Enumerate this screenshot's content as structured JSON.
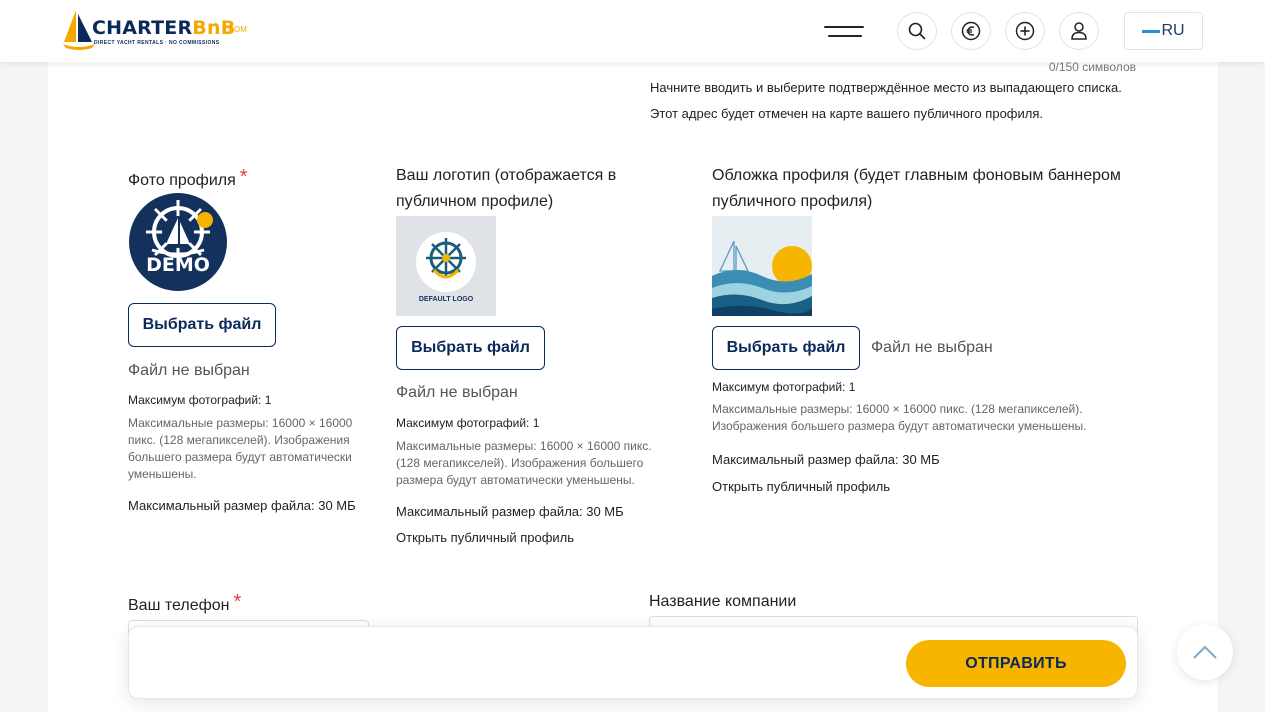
{
  "header": {
    "logo": {
      "brand_part1": "CHARTER",
      "brand_part2": "BnB",
      "domain": ".COM",
      "tagline": "DIRECT YACHT RENTALS · NO COMMISSIONS"
    },
    "icons": [
      "menu-icon",
      "search-icon",
      "euro-icon",
      "plus-circle-icon",
      "user-icon"
    ],
    "language": "RU"
  },
  "address": {
    "counter": "0/150 символов",
    "help": "Начните вводить и выберите подтверждённое место из выпадающего списка. Этот адрес будет отмечен на карте вашего публичного профиля."
  },
  "profile_photo": {
    "label": "Фото профиля",
    "required_mark": "*",
    "image_text": "DEMO",
    "button": "Выбрать файл",
    "no_file": "Файл не выбран",
    "max_photos": "Максимум фотографий: 1",
    "max_dims": "Максимальные размеры: 16000 × 16000 пикс. (128 мегапикселей). Изображения большего размера будут автоматически уменьшены.",
    "max_size": "Максимальный размер файла: 30 МБ"
  },
  "logo_upload": {
    "label": "Ваш логотип (отображается в публичном профиле)",
    "image_text": "DEFAULT LOGO",
    "button": "Выбрать файл",
    "no_file": "Файл не выбран",
    "max_photos": "Максимум фотографий: 1",
    "max_dims": "Максимальные размеры: 16000 × 16000 пикс. (128 мегапикселей). Изображения большего размера будут автоматически уменьшены.",
    "max_size": "Максимальный размер файла: 30 МБ",
    "public_link": "Открыть публичный профиль"
  },
  "cover_upload": {
    "label": "Обложка профиля (будет главным фоновым баннером публичного профиля)",
    "button": "Выбрать файл",
    "no_file": "Файл не выбран",
    "max_photos": "Максимум фотографий: 1",
    "max_dims": "Максимальные размеры: 16000 × 16000 пикс. (128 мегапикселей). Изображения большего размера будут автоматически уменьшены.",
    "max_size": "Максимальный размер файла: 30 МБ",
    "public_link": "Открыть публичный профиль"
  },
  "phone": {
    "label": "Ваш телефон",
    "required_mark": "*",
    "value": ""
  },
  "company": {
    "label": "Название компании",
    "value": ""
  },
  "submit": {
    "label": "ОТПРАВИТЬ"
  },
  "colors": {
    "navy": "#0b2a5a",
    "accent": "#f7b500",
    "required": "#e23b3b"
  }
}
